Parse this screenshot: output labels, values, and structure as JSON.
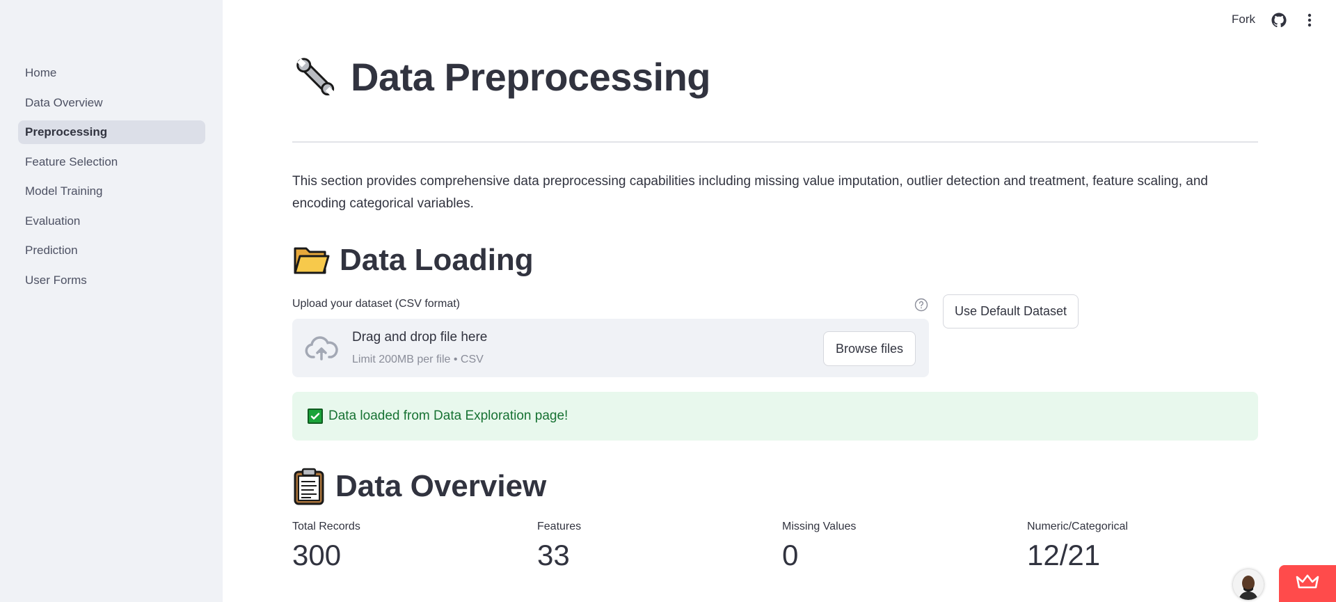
{
  "sidebar": {
    "items": [
      {
        "label": "Home"
      },
      {
        "label": "Data Overview"
      },
      {
        "label": "Preprocessing"
      },
      {
        "label": "Feature Selection"
      },
      {
        "label": "Model Training"
      },
      {
        "label": "Evaluation"
      },
      {
        "label": "Prediction"
      },
      {
        "label": "User Forms"
      }
    ],
    "active_index": 2
  },
  "topbar": {
    "fork_label": "Fork"
  },
  "page": {
    "title": "Data Preprocessing",
    "title_icon": "wrench-icon",
    "intro": "This section provides comprehensive data preprocessing capabilities including missing value imputation, outlier detection and treatment, feature scaling, and encoding categorical variables."
  },
  "data_loading": {
    "heading": "Data Loading",
    "heading_icon": "folder-icon",
    "upload_label": "Upload your dataset (CSV format)",
    "dropzone_title": "Drag and drop file here",
    "dropzone_subtitle": "Limit 200MB per file • CSV",
    "browse_label": "Browse files",
    "default_button_label": "Use Default Dataset",
    "success_message": "Data loaded from Data Exploration page!"
  },
  "data_overview": {
    "heading": "Data Overview",
    "heading_icon": "clipboard-icon",
    "metrics": [
      {
        "label": "Total Records",
        "value": "300"
      },
      {
        "label": "Features",
        "value": "33"
      },
      {
        "label": "Missing Values",
        "value": "0"
      },
      {
        "label": "Numeric/Categorical",
        "value": "12/21"
      }
    ]
  },
  "colors": {
    "accent": "#FF4B4B",
    "sidebar_bg": "#F0F2F6",
    "success_bg": "#E8F8ED",
    "success_text": "#177233",
    "text": "#31333F"
  }
}
